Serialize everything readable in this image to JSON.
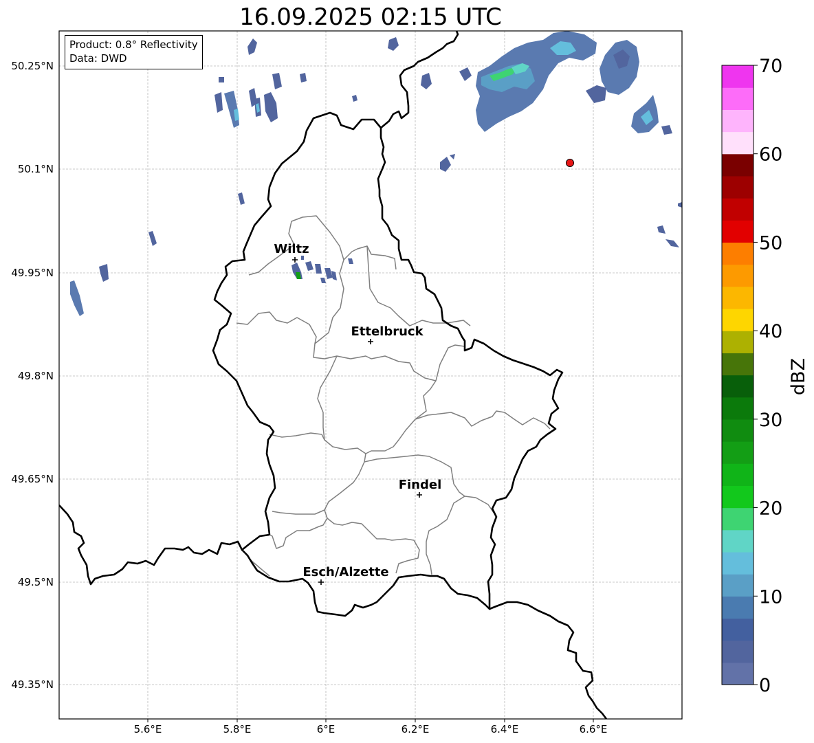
{
  "title": "16.09.2025 02:15 UTC",
  "info_box": {
    "product": "Product: 0.8° Reflectivity",
    "data": "Data: DWD"
  },
  "axes": {
    "lon_ticks": [
      "5.6°E",
      "5.8°E",
      "6°E",
      "6.2°E",
      "6.4°E",
      "6.6°E"
    ],
    "lat_ticks": [
      "50.25°N",
      "50.1°N",
      "49.95°N",
      "49.8°N",
      "49.65°N",
      "49.5°N",
      "49.35°N"
    ]
  },
  "cities": [
    {
      "name": "Wiltz"
    },
    {
      "name": "Ettelbruck"
    },
    {
      "name": "Findel"
    },
    {
      "name": "Esch/Alzette"
    }
  ],
  "colorbar": {
    "label": "dBZ",
    "ticks": [
      "0",
      "10",
      "20",
      "30",
      "40",
      "50",
      "60",
      "70"
    ],
    "min": 0,
    "max": 70,
    "colors": [
      "#6272a8",
      "#52659e",
      "#43609f",
      "#4a7bb0",
      "#5a9fc6",
      "#64bedc",
      "#60d5c6",
      "#3ed472",
      "#12c81c",
      "#10b418",
      "#139e15",
      "#108c10",
      "#0b7a0b",
      "#085f0a",
      "#477509",
      "#adb101",
      "#fed600",
      "#fcb700",
      "#fd9a00",
      "#fd7e00",
      "#e20000",
      "#c10000",
      "#9d0000",
      "#7a0000",
      "#ffe0fb",
      "#feb4fc",
      "#fd6cf9",
      "#ef35ef"
    ]
  },
  "colors": {
    "border_national": "#000000",
    "border_district": "#808080",
    "gridline": "#b8b8b8",
    "marker": "#e81515"
  }
}
